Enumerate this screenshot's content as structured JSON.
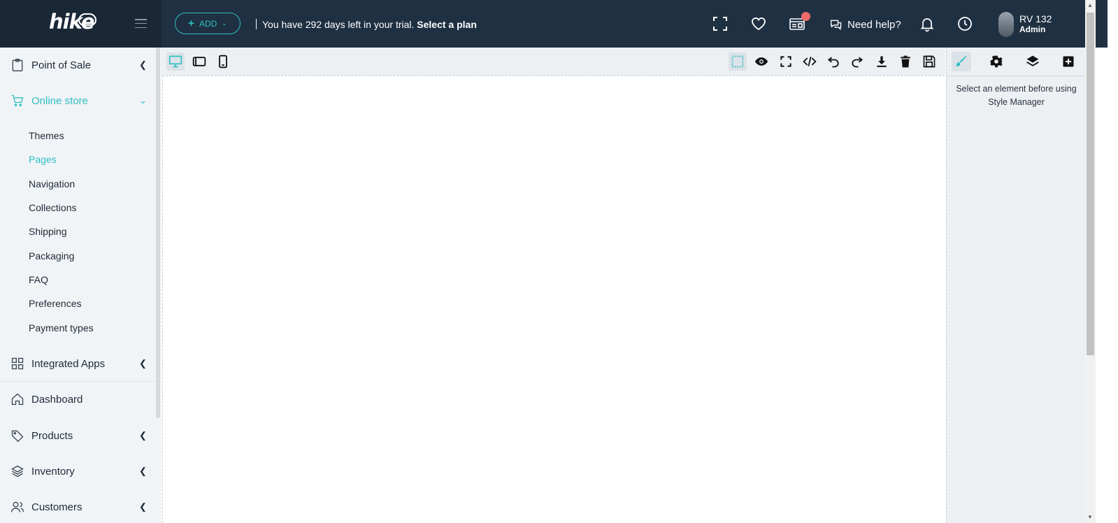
{
  "app": {
    "logo_text": "hike",
    "add_label": "ADD",
    "trial_text": "You have 292 days left in your trial.",
    "trial_link": "Select a plan",
    "help_label": "Need help?",
    "user_name": "RV 132",
    "user_role": "Admin",
    "accent_color": "#2dbfc1",
    "topbar_color": "#1f3042",
    "notification_color": "#ef6a6a"
  },
  "sidebar": {
    "point_of_sale": "Point of Sale",
    "online_store": "Online store",
    "sub_items": [
      "Themes",
      "Pages",
      "Navigation",
      "Collections",
      "Shipping",
      "Packaging",
      "FAQ",
      "Preferences",
      "Payment types"
    ],
    "active_sub_item": "Pages",
    "integrated_apps": "Integrated Apps",
    "dashboard": "Dashboard",
    "products": "Products",
    "inventory": "Inventory",
    "customers": "Customers"
  },
  "editor": {
    "active_device": "desktop",
    "devices": [
      "desktop-icon",
      "tablet-icon",
      "mobile-icon"
    ],
    "tools": [
      "component-outline-icon",
      "preview-eye-icon",
      "fullscreen-icon",
      "code-icon",
      "undo-icon",
      "redo-icon",
      "download-icon",
      "trash-icon",
      "save-icon"
    ]
  },
  "panel": {
    "tabs": [
      "style-manager-brush-icon",
      "settings-gear-icon",
      "layers-icon",
      "add-block-icon"
    ],
    "message": "Select an element before using Style Manager"
  }
}
